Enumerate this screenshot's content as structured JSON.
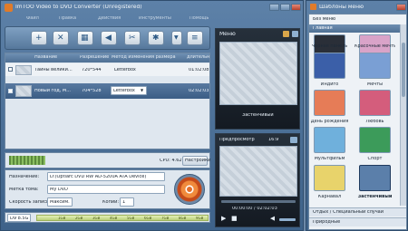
{
  "main_window": {
    "title": "ImTOO Video to DVD Converter (Unregistered)",
    "menu": [
      "Файл",
      "Правка",
      "Действия",
      "Инструменты",
      "Помощь"
    ],
    "table": {
      "headers": [
        "Название",
        "Разрешение",
        "Метод изменения размера",
        "длительн"
      ],
      "rows": [
        {
          "name": "Тайны велики...",
          "resolution": "720*544",
          "resize": "Letterbox",
          "duration": "01:02:08",
          "selected": false
        },
        {
          "name": "Новый год, М...",
          "resolution": "704*528",
          "resize": "Letterbox",
          "duration": "02:02:03",
          "selected": true
        }
      ]
    },
    "cpu": "CPU: 4.62%",
    "settings_button": "Настройки",
    "destination_label": "Назначение:",
    "destination_value": "D:(Optiarc DVD RW AD-5200A ATA Device)",
    "volume_label": "Метка тома:",
    "volume_value": "My DVD",
    "speed_label": "Скорость записи:",
    "speed_value": "Максим.",
    "copies_label": "Копии:",
    "copies_value": "1",
    "disc_size": "D9 8.5G",
    "scale_ticks": [
      "1GB",
      "2GB",
      "3GB",
      "4GB",
      "5GB",
      "6GB",
      "7GB",
      "8GB",
      "9GB"
    ],
    "menu_panel_title": "Меню",
    "menu_preview_caption": "Застенчивый",
    "preview_title": "Предпросмотр",
    "preview_ratio": "16:9",
    "preview_time": "00:00:00 / 02:02:03"
  },
  "templates_window": {
    "title": "Шаблоны меню",
    "no_menu": "Без меню",
    "category": "Главная",
    "templates": [
      {
        "label": "Черная панель",
        "color": "#2a2f38"
      },
      {
        "label": "Красочные мечты",
        "color": "#d9a3c8"
      },
      {
        "label": "Индиго",
        "color": "#3b5fa8"
      },
      {
        "label": "Мечты",
        "color": "#7a9fd4"
      },
      {
        "label": "День рождения",
        "color": "#e67c57"
      },
      {
        "label": "Любовь",
        "color": "#d45d7c"
      },
      {
        "label": "Мультфильм",
        "color": "#6fb0dc"
      },
      {
        "label": "Спорт",
        "color": "#3c9b5a"
      },
      {
        "label": "Карнавал",
        "color": "#e8d36b"
      },
      {
        "label": "Застенчивый",
        "color": "#5b7faa"
      }
    ],
    "footer_category": "Отдых / Специальный случай",
    "footer_item": "Природные"
  }
}
